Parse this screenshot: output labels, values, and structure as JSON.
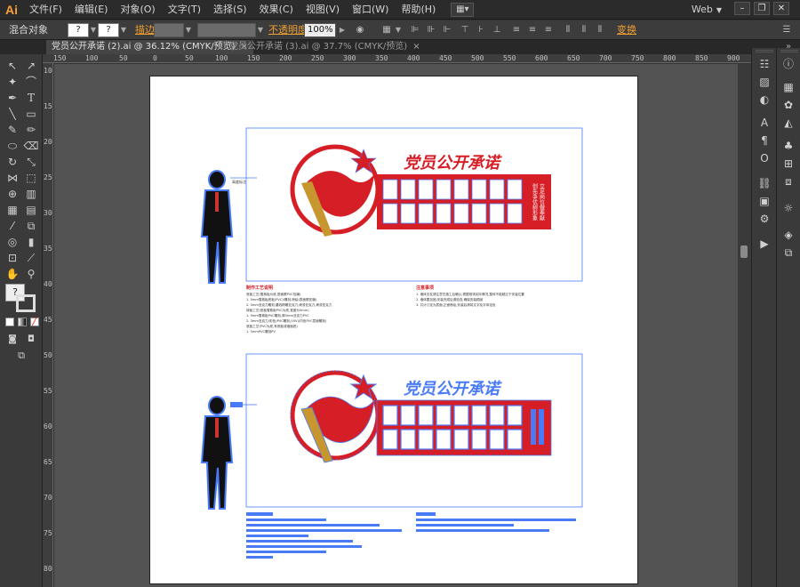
{
  "app": {
    "logo": "Ai",
    "workspace": "Web"
  },
  "menu": [
    "文件(F)",
    "编辑(E)",
    "对象(O)",
    "文字(T)",
    "选择(S)",
    "效果(C)",
    "视图(V)",
    "窗口(W)",
    "帮助(H)"
  ],
  "control": {
    "object_type": "混合对象",
    "stroke_label": "描边",
    "opacity_label": "不透明度",
    "opacity_value": "100%",
    "transform_label": "变换",
    "unknown_swatch": "?"
  },
  "tabs": [
    {
      "label": "党员公开承诺 (2).ai @ 36.12% (CMYK/预览)",
      "active": true
    },
    {
      "label": "党员公开承诺 (3).ai @ 37.7% (CMYK/预览)",
      "active": false
    }
  ],
  "ruler": {
    "h": [
      "150",
      "100",
      "50",
      "0",
      "50",
      "100",
      "150",
      "200",
      "250",
      "300",
      "350",
      "400",
      "450",
      "500",
      "550",
      "600",
      "650",
      "700",
      "750",
      "800",
      "850",
      "900"
    ],
    "v": [
      "100",
      "150",
      "200",
      "250",
      "300",
      "350",
      "400",
      "450",
      "500",
      "550",
      "600",
      "650",
      "700",
      "750",
      "800"
    ]
  },
  "artwork": {
    "headline": "党员公开承诺",
    "side_slogan_1": "立足岗位做奉献",
    "side_slogan_2": "创先争优树形象",
    "callout_small": "高度标注",
    "notes_left_title": "制作工艺说明",
    "notes_left": [
      "底板工艺(雪弗板为底,表面覆PVC包膜)",
      "1. 5mm雪弗板底板(PVC)/雕刻,喷绘(表面覆亚膜)",
      "2. 5mm亚克力雕刻,腰线精雕亚克力,烤漆亚克力,烤漆亚克力",
      "绿板工艺(底板雪弗板PVC为底,宽度为5mm)",
      "1. 5mm雪弗板PVC雕刻,厚5mm亚克力PVC",
      "2. 3mm亚克力(彩色)PVC雕刻,(VIV)(内色PVC层面雕刻)",
      "底板工艺(PVC为底,有底板或墙面底)",
      "1. 5mmPVC雕刻PV"
    ],
    "notes_right_title": "注意事项",
    "notes_right": [
      "1. 墙体支柱请注意在施工后确认,根据现场实际情况,整体不能超过于安装位置",
      "2. 墙体要加固,安装完成后请检查,确保安装稳固",
      "3. 共计订定为层面,正面喷绘,安装后请将文字及字体定色"
    ]
  },
  "colors": {
    "accent": "#f0a030",
    "brand_red": "#d61e26",
    "selection": "#4a7bf7",
    "app_bg": "#323232"
  }
}
